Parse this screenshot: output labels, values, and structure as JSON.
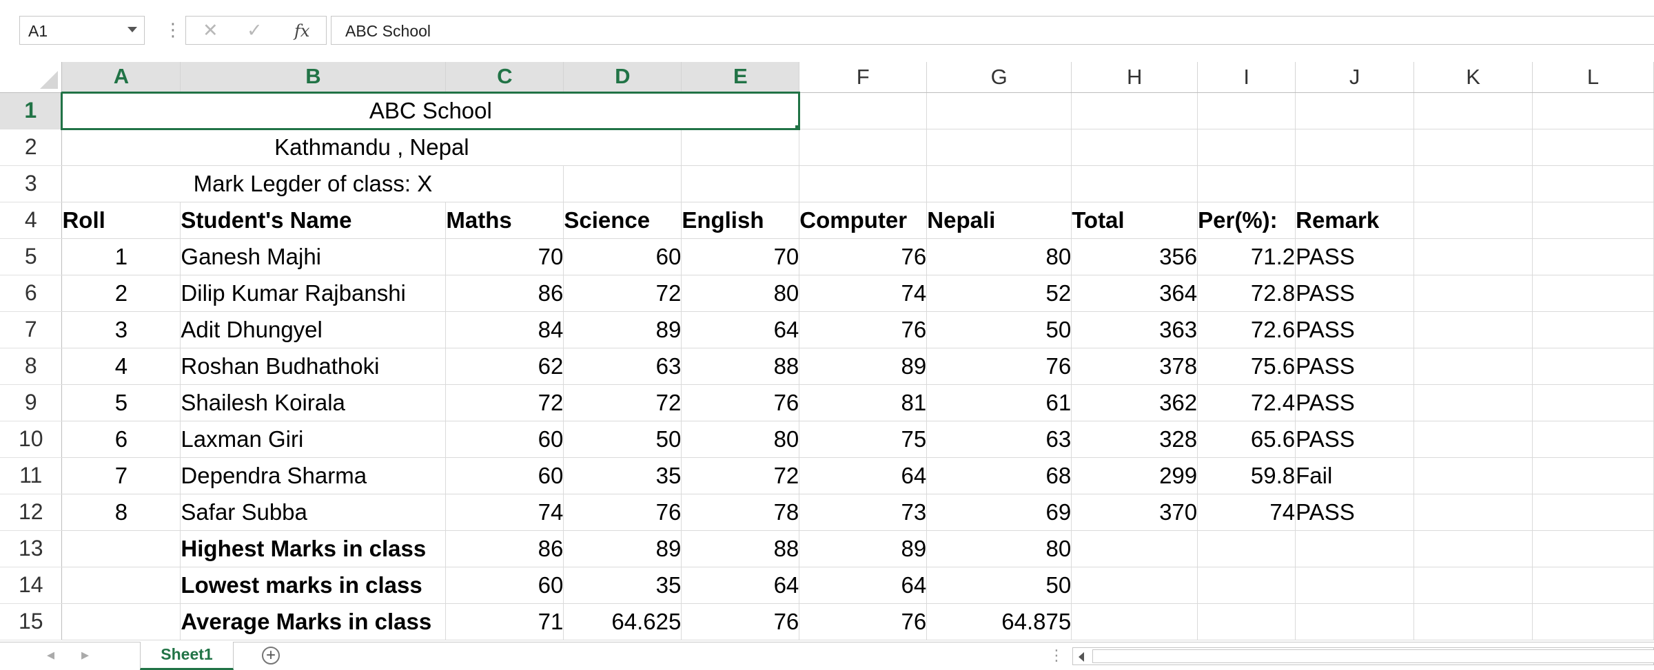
{
  "formula_bar": {
    "name_box": "A1",
    "separator": "⋮",
    "cancel_glyph": "✕",
    "enter_glyph": "✓",
    "fx_label": "fx",
    "value": "ABC School"
  },
  "columns": [
    "A",
    "B",
    "C",
    "D",
    "E",
    "F",
    "G",
    "H",
    "I",
    "J",
    "K",
    "L"
  ],
  "rows": [
    {
      "num": "1",
      "cells": []
    },
    {
      "num": "2",
      "cells": []
    },
    {
      "num": "3",
      "cells": []
    },
    {
      "num": "4",
      "cells": [
        "Roll",
        "Student's Name",
        "Maths",
        "Science",
        "English",
        "Computer",
        "Nepali",
        "Total",
        "Per(%):",
        "Remark",
        "",
        ""
      ]
    },
    {
      "num": "5",
      "cells": [
        "1",
        "Ganesh Majhi",
        "70",
        "60",
        "70",
        "76",
        "80",
        "356",
        "71.2",
        "PASS",
        "",
        ""
      ]
    },
    {
      "num": "6",
      "cells": [
        "2",
        "Dilip Kumar Rajbanshi",
        "86",
        "72",
        "80",
        "74",
        "52",
        "364",
        "72.8",
        "PASS",
        "",
        ""
      ]
    },
    {
      "num": "7",
      "cells": [
        "3",
        "Adit Dhungyel",
        "84",
        "89",
        "64",
        "76",
        "50",
        "363",
        "72.6",
        "PASS",
        "",
        ""
      ]
    },
    {
      "num": "8",
      "cells": [
        "4",
        "Roshan Budhathoki",
        "62",
        "63",
        "88",
        "89",
        "76",
        "378",
        "75.6",
        "PASS",
        "",
        ""
      ]
    },
    {
      "num": "9",
      "cells": [
        "5",
        "Shailesh Koirala",
        "72",
        "72",
        "76",
        "81",
        "61",
        "362",
        "72.4",
        "PASS",
        "",
        ""
      ]
    },
    {
      "num": "10",
      "cells": [
        "6",
        "Laxman Giri",
        "60",
        "50",
        "80",
        "75",
        "63",
        "328",
        "65.6",
        "PASS",
        "",
        ""
      ]
    },
    {
      "num": "11",
      "cells": [
        "7",
        "Dependra Sharma",
        "60",
        "35",
        "72",
        "64",
        "68",
        "299",
        "59.8",
        "Fail",
        "",
        ""
      ]
    },
    {
      "num": "12",
      "cells": [
        "8",
        "Safar Subba",
        "74",
        "76",
        "78",
        "73",
        "69",
        "370",
        "74",
        "PASS",
        "",
        ""
      ]
    },
    {
      "num": "13",
      "cells": [
        "",
        "Highest Marks in class",
        "86",
        "89",
        "88",
        "89",
        "80",
        "",
        "",
        "",
        "",
        ""
      ]
    },
    {
      "num": "14",
      "cells": [
        "",
        "Lowest marks in class",
        "60",
        "35",
        "64",
        "64",
        "50",
        "",
        "",
        "",
        "",
        ""
      ]
    },
    {
      "num": "15",
      "cells": [
        "",
        "Average Marks in class",
        "71",
        "64.625",
        "76",
        "76",
        "64.875",
        "",
        "",
        "",
        "",
        ""
      ]
    }
  ],
  "merged": {
    "school_name": "ABC School",
    "location": "Kathmandu , Nepal",
    "ledger_title": "Mark Legder of class: X"
  },
  "sheet_tabs": {
    "prev": "◂",
    "next": "▸",
    "active": "Sheet1",
    "add": "+",
    "dots": "⋮"
  },
  "colors": {
    "accent": "#217346",
    "header_selected_bg": "#e1e1e1",
    "gridline": "#dadada"
  }
}
